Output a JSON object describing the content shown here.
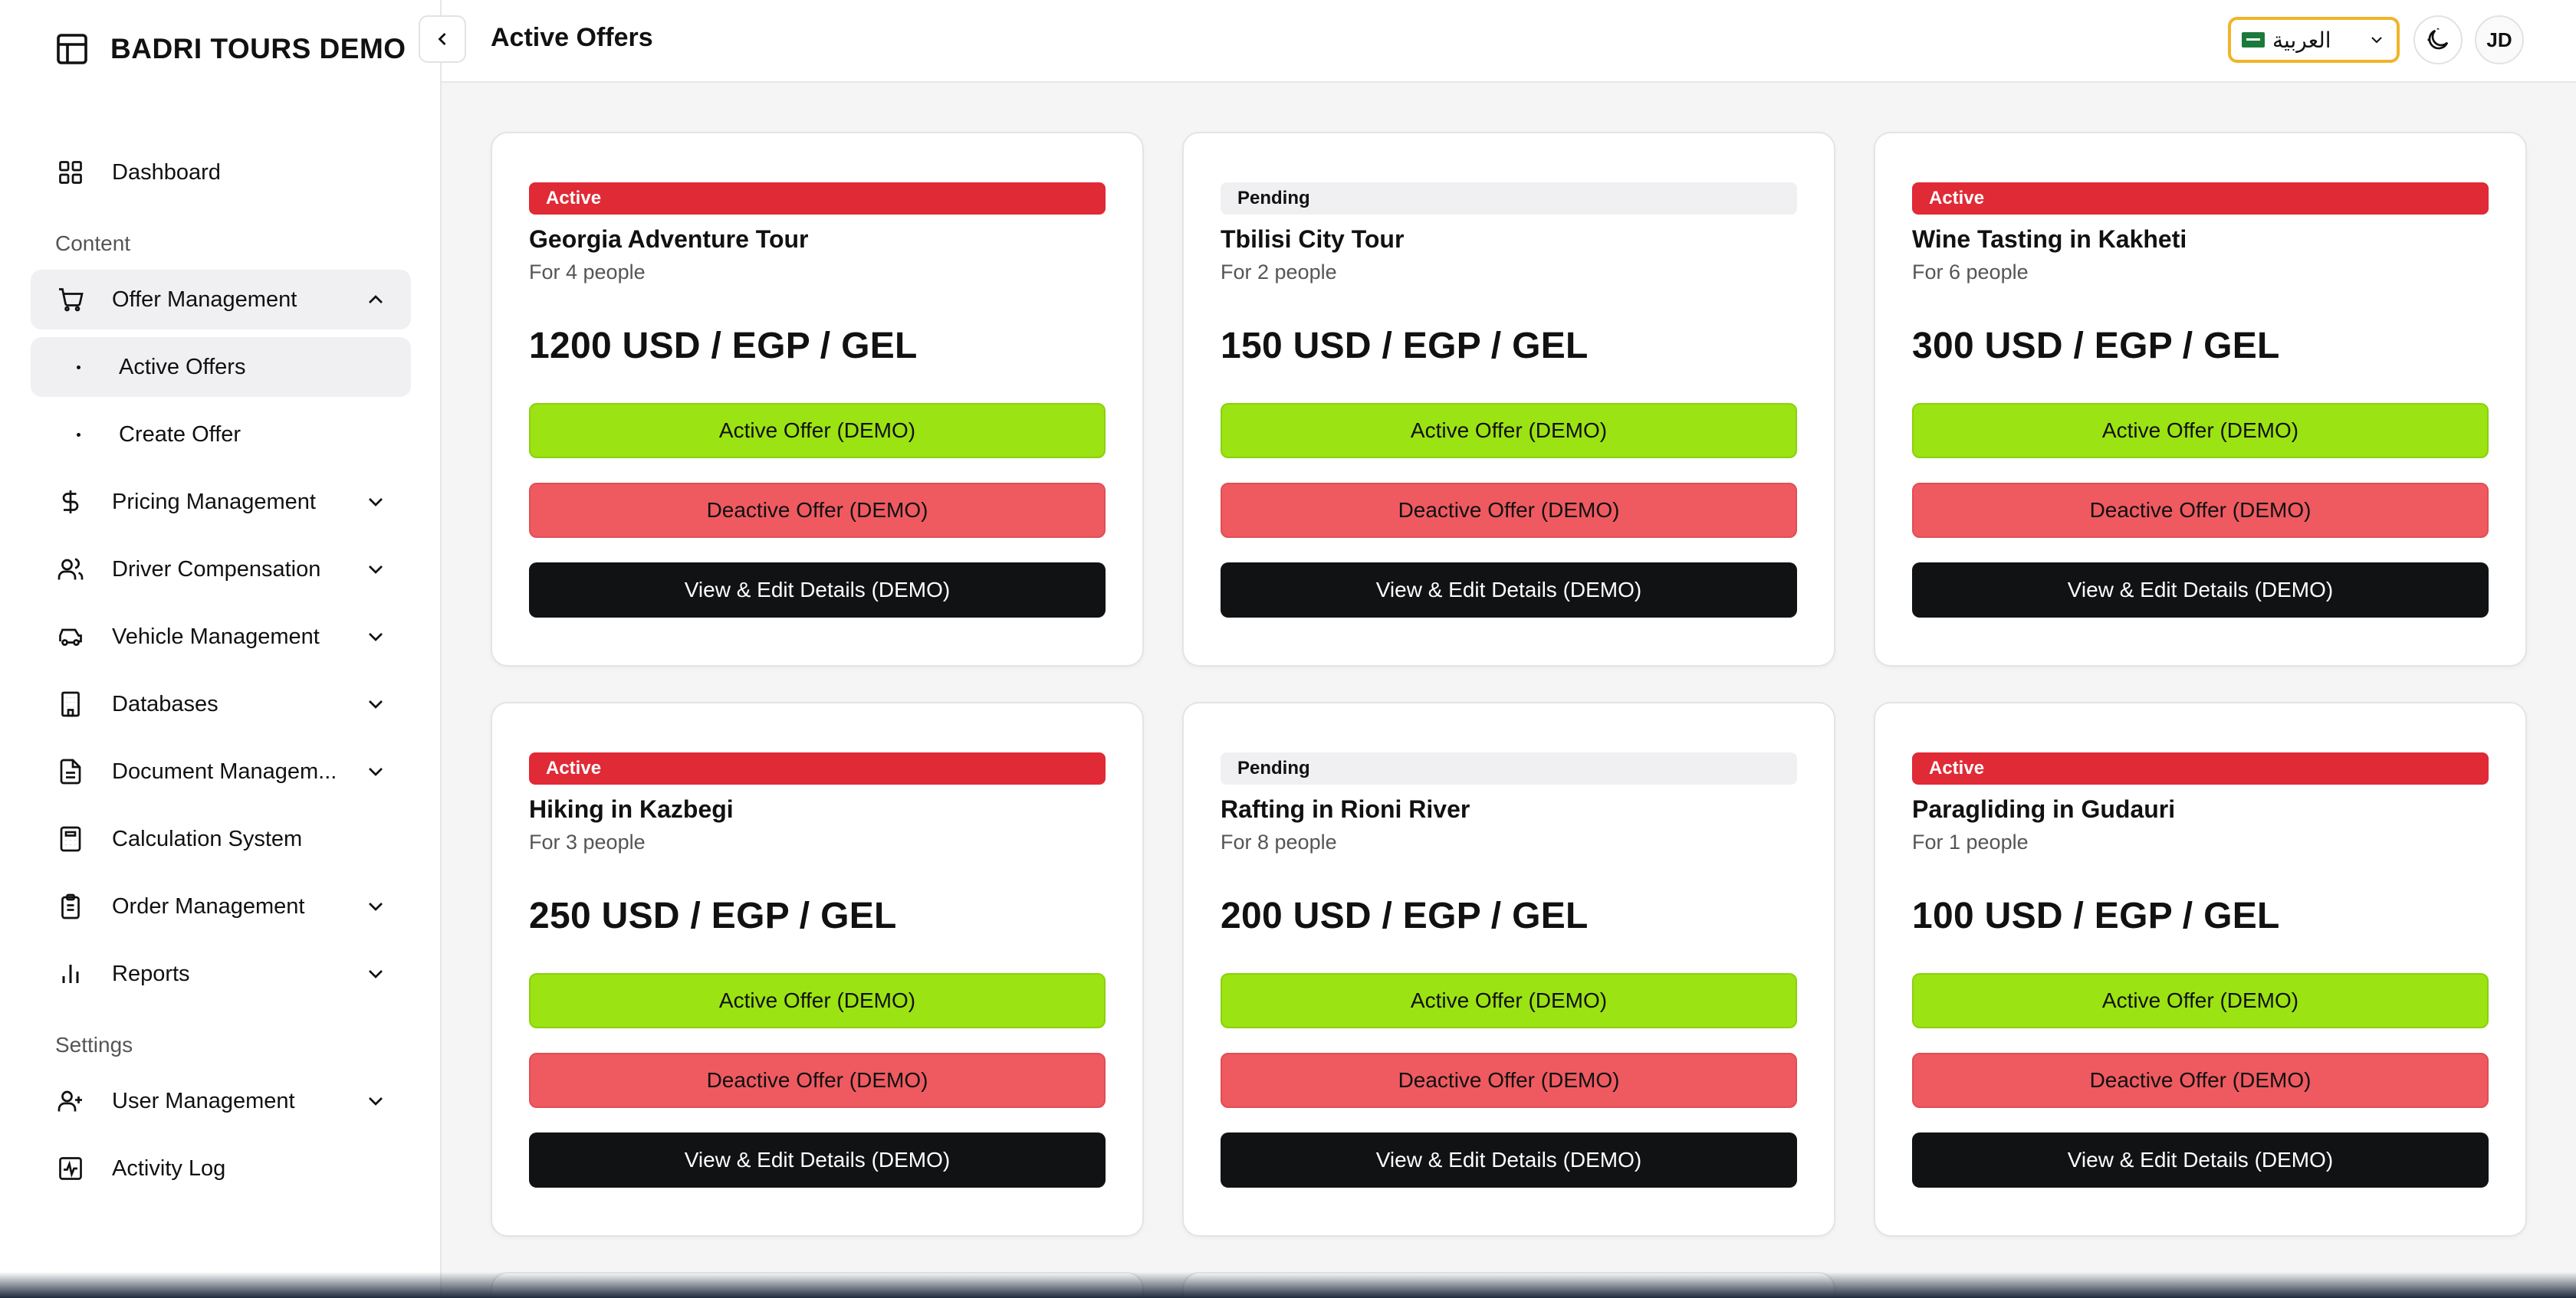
{
  "app": {
    "brand": "BADRI TOURS DEMO"
  },
  "header": {
    "title": "Active Offers",
    "language": "العربية",
    "avatar_initials": "JD"
  },
  "sidebar": {
    "dashboard": "Dashboard",
    "content_label": "Content",
    "offer_management": "Offer Management",
    "active_offers": "Active Offers",
    "create_offer": "Create Offer",
    "pricing_management": "Pricing Management",
    "driver_compensation": "Driver Compensation",
    "vehicle_management": "Vehicle Management",
    "databases": "Databases",
    "document_management": "Document Managem...",
    "calculation_system": "Calculation System",
    "order_management": "Order Management",
    "reports": "Reports",
    "settings_label": "Settings",
    "user_management": "User Management",
    "activity_log": "Activity Log"
  },
  "buttons": {
    "activate": "Active Offer (DEMO)",
    "deactivate": "Deactive Offer (DEMO)",
    "details": "View & Edit Details (DEMO)"
  },
  "offers": [
    {
      "status": "Active",
      "title": "Georgia Adventure Tour",
      "people": "For 4 people",
      "price": "1200 USD / EGP / GEL"
    },
    {
      "status": "Pending",
      "title": "Tbilisi City Tour",
      "people": "For 2 people",
      "price": "150 USD / EGP / GEL"
    },
    {
      "status": "Active",
      "title": "Wine Tasting in Kakheti",
      "people": "For 6 people",
      "price": "300 USD / EGP / GEL"
    },
    {
      "status": "Active",
      "title": "Hiking in Kazbegi",
      "people": "For 3 people",
      "price": "250 USD / EGP / GEL"
    },
    {
      "status": "Pending",
      "title": "Rafting in Rioni River",
      "people": "For 8 people",
      "price": "200 USD / EGP / GEL"
    },
    {
      "status": "Active",
      "title": "Paragliding in Gudauri",
      "people": "For 1 people",
      "price": "100 USD / EGP / GEL"
    }
  ],
  "colors": {
    "active_badge": "#e02a36",
    "pending_badge": "#f0f0f2",
    "green": "#9be313",
    "salmon": "#ee5a60",
    "black": "#111214",
    "lang_border": "#f0b429"
  }
}
